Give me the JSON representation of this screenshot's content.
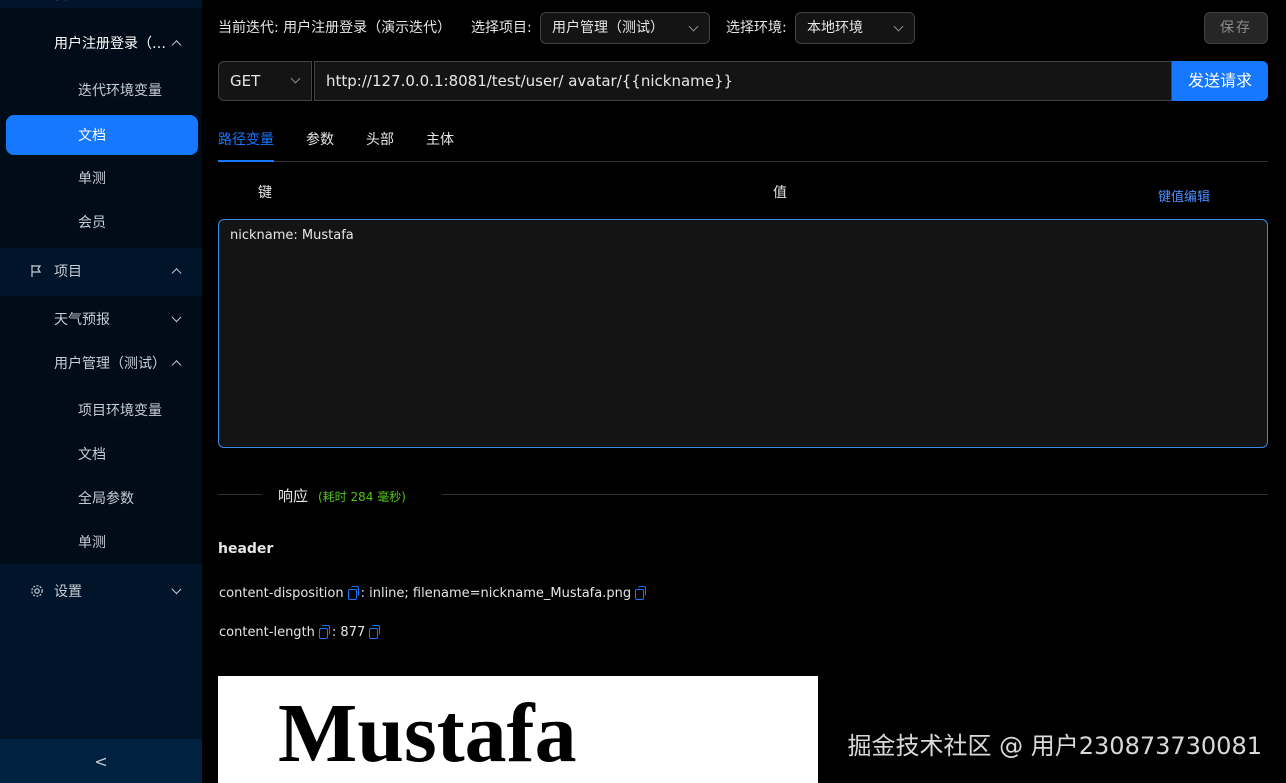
{
  "sidebar": {
    "top_partial": "迭代",
    "items": [
      {
        "label": "用户注册登录（演示迭代）",
        "level": 1,
        "open": true
      },
      {
        "label": "迭代环境变量",
        "level": 2
      },
      {
        "label": "文档",
        "level": 2,
        "active": true
      },
      {
        "label": "单测",
        "level": 2
      },
      {
        "label": "会员",
        "level": 2
      },
      {
        "label": "项目",
        "level": 0,
        "icon": "flag-icon",
        "open": true
      },
      {
        "label": "天气预报",
        "level": 1,
        "open": false
      },
      {
        "label": "用户管理（测试）",
        "level": 1,
        "open": true
      },
      {
        "label": "项目环境变量",
        "level": 2
      },
      {
        "label": "文档",
        "level": 2
      },
      {
        "label": "全局参数",
        "level": 2
      },
      {
        "label": "单测",
        "level": 2
      },
      {
        "label": "设置",
        "level": 0,
        "icon": "gear-icon",
        "open": false
      }
    ],
    "collapse_glyph": "<"
  },
  "topbar": {
    "iteration_text": "当前迭代: 用户注册登录（演示迭代）",
    "project_label": "选择项目:",
    "project_value": "用户管理（测试）",
    "env_label": "选择环境:",
    "env_value": "本地环境",
    "save_label": "保存"
  },
  "request": {
    "method": "GET",
    "url": "http://127.0.0.1:8081/test/user/ avatar/{{nickname}}",
    "send_label": "发送请求"
  },
  "tabs": [
    {
      "label": "路径变量",
      "active": true
    },
    {
      "label": "参数"
    },
    {
      "label": "头部"
    },
    {
      "label": "主体"
    }
  ],
  "kv": {
    "key_header": "键",
    "value_header": "值",
    "edit_link": "键值编辑",
    "text": "nickname: Mustafa"
  },
  "response": {
    "title": "响应",
    "time_text": "(耗时 284 毫秒)",
    "header_title": "header",
    "headers": [
      {
        "key": "content-disposition",
        "value": "inline; filename=nickname_Mustafa.png"
      },
      {
        "key": "content-length",
        "value": "877"
      }
    ],
    "preview_text": "Mustafa"
  },
  "watermark": "掘金技术社区 @ 用户230873730081",
  "colors": {
    "accent": "#1677ff",
    "success": "#52c41a",
    "sidebar_bg": "#001529"
  }
}
